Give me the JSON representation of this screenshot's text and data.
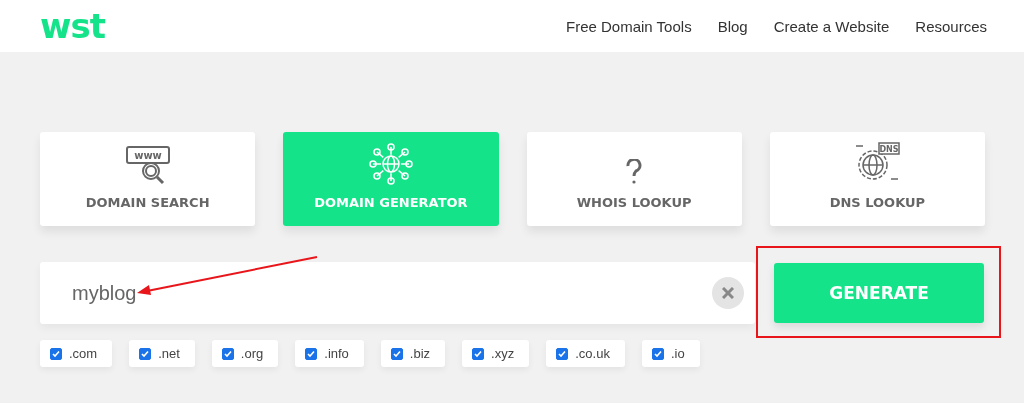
{
  "header": {
    "logo": "wst",
    "nav": [
      "Free Domain Tools",
      "Blog",
      "Create a Website",
      "Resources"
    ]
  },
  "tools": [
    {
      "label": "DOMAIN SEARCH",
      "kind": "search",
      "icon_text": "www",
      "selected": false
    },
    {
      "label": "DOMAIN GENERATOR",
      "kind": "generator",
      "selected": true
    },
    {
      "label": "WHOIS LOOKUP",
      "kind": "whois",
      "selected": false
    },
    {
      "label": "DNS LOOKUP",
      "kind": "dns",
      "icon_text": "DNS",
      "selected": false
    }
  ],
  "search": {
    "value": "myblog"
  },
  "generate_button": "GENERATE",
  "extensions": [
    {
      "label": ".com",
      "checked": true
    },
    {
      "label": ".net",
      "checked": true
    },
    {
      "label": ".org",
      "checked": true
    },
    {
      "label": ".info",
      "checked": true
    },
    {
      "label": ".biz",
      "checked": true
    },
    {
      "label": ".xyz",
      "checked": true
    },
    {
      "label": ".co.uk",
      "checked": true
    },
    {
      "label": ".io",
      "checked": true
    }
  ]
}
